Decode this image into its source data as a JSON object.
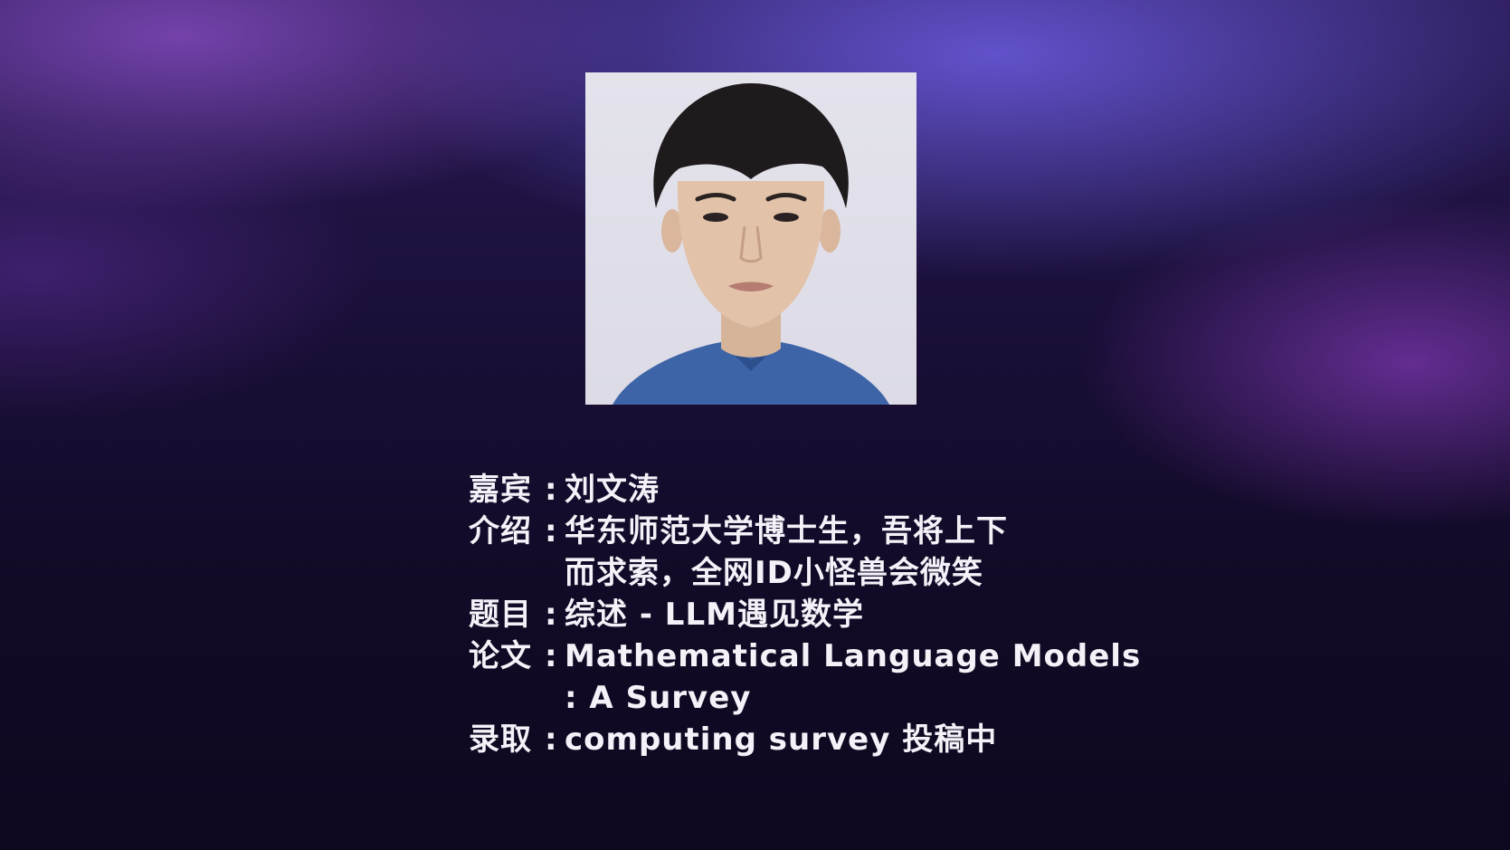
{
  "portrait": {
    "icon": "person-photo",
    "background_color": "#e3e2eb"
  },
  "info": {
    "colon": ":",
    "guest": {
      "label": "嘉宾",
      "value": "刘文涛"
    },
    "intro": {
      "label": "介绍",
      "lines": [
        "华东师范大学博士生，吾将上下",
        "而求索，全网ID小怪兽会微笑"
      ]
    },
    "topic": {
      "label": "题目",
      "value": "综述 - LLM遇见数学"
    },
    "paper": {
      "label": "论文",
      "lines": [
        "Mathematical Language Models",
        ": A Survey"
      ]
    },
    "accepted": {
      "label": "录取",
      "value": "computing survey 投稿中"
    }
  },
  "colors": {
    "text": "#f4f2f8",
    "bg_dark": "#120a26",
    "glow_blue": "#6455d2",
    "glow_purple": "#a046dc"
  }
}
